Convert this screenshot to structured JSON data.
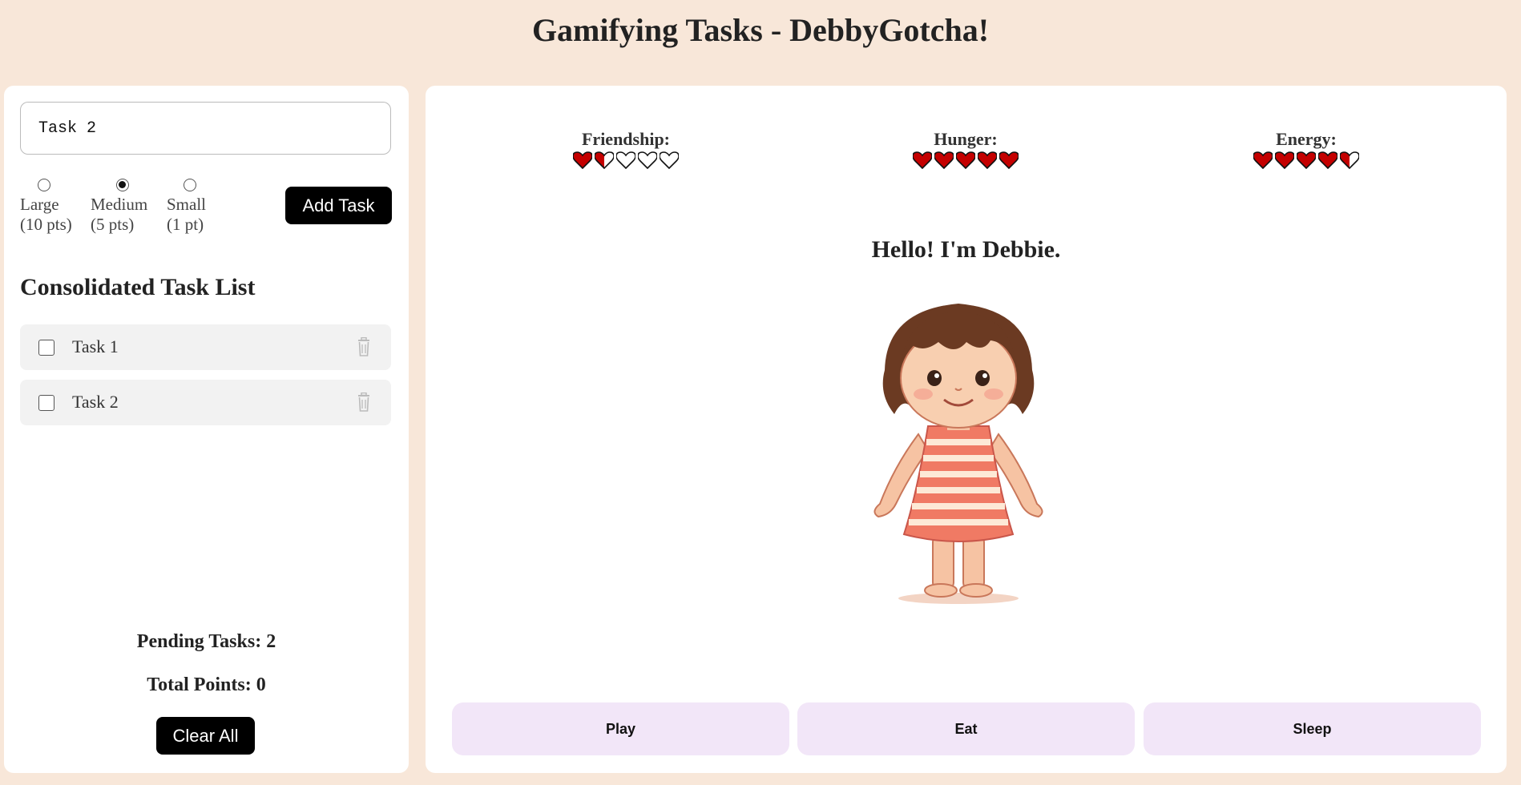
{
  "header": {
    "title": "Gamifying Tasks - DebbyGotcha!"
  },
  "task_form": {
    "input_value": "Task 2",
    "sizes": [
      {
        "name": "Large",
        "points": "(10 pts)",
        "selected": false
      },
      {
        "name": "Medium",
        "points": "(5 pts)",
        "selected": true
      },
      {
        "name": "Small",
        "points": "(1 pt)",
        "selected": false
      }
    ],
    "add_label": "Add Task"
  },
  "task_list": {
    "heading": "Consolidated Task List",
    "items": [
      {
        "label": "Task 1",
        "checked": false
      },
      {
        "label": "Task 2",
        "checked": false
      }
    ]
  },
  "summary": {
    "pending_label": "Pending Tasks: 2",
    "points_label": "Total Points: 0",
    "clear_label": "Clear All"
  },
  "meters": [
    {
      "label": "Friendship:",
      "hearts": 1.5,
      "max": 5
    },
    {
      "label": "Hunger:",
      "hearts": 5,
      "max": 5
    },
    {
      "label": "Energy:",
      "hearts": 4.5,
      "max": 5
    }
  ],
  "pet": {
    "greeting": "Hello! I'm Debbie."
  },
  "actions": {
    "play": "Play",
    "eat": "Eat",
    "sleep": "Sleep"
  },
  "colors": {
    "background": "#f8e7d9",
    "heart_red": "#c40000",
    "action_bg": "#f2e6f8",
    "button_black": "#000000"
  }
}
